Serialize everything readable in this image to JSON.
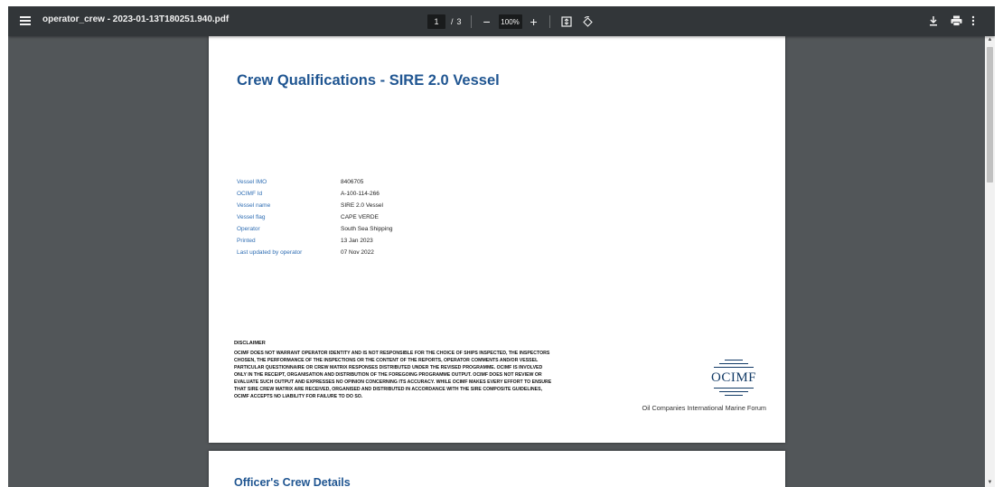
{
  "toolbar": {
    "file_title": "operator_crew - 2023-01-13T180251.940.pdf",
    "current_page": "1",
    "page_separator": "/",
    "total_pages": "3",
    "zoom_out": "−",
    "zoom_level": "100%",
    "zoom_in": "+",
    "icons": [
      "menu-icon",
      "fit-page-icon",
      "rotate-icon",
      "download-icon",
      "print-icon",
      "more-icon"
    ]
  },
  "document": {
    "title": "Crew Qualifications - SIRE 2.0 Vessel",
    "info": [
      {
        "label": "Vessel IMO",
        "value": "8406705"
      },
      {
        "label": "OCIMF Id",
        "value": "A-100-114-266"
      },
      {
        "label": "Vessel name",
        "value": "SIRE 2.0 Vessel"
      },
      {
        "label": "Vessel flag",
        "value": "CAPE VERDE"
      },
      {
        "label": "Operator",
        "value": "South Sea Shipping"
      },
      {
        "label": "Printed",
        "value": "13 Jan 2023"
      },
      {
        "label": "Last updated by operator",
        "value": "07 Nov 2022"
      }
    ],
    "disclaimer_title": "DISCLAIMER",
    "disclaimer_lines": [
      "OCIMF DOES NOT WARRANT OPERATOR IDENTITY AND IS NOT RESPONSIBLE FOR THE CHOICE OF SHIPS INSPECTED, THE INSPECTORS",
      "CHOSEN, THE PERFORMANCE OF THE INSPECTIONS OR THE CONTENT OF THE REPORTS, OPERATOR COMMENTS AND/OR VESSEL",
      "PARTICULAR QUESTIONNAIRE OR CREW MATRIX RESPONSES DISTRIBUTED UNDER THE REVISED PROGRAMME. OCIMF IS INVOLVED",
      "ONLY IN THE RECEIPT, ORGANISATION AND DISTRIBUTION OF THE FOREGOING PROGRAMME OUTPUT. OCIMF DOES NOT REVIEW OR",
      "EVALUATE SUCH OUTPUT AND EXPRESSES NO OPINION CONCERNING ITS ACCURACY. WHILE OCIMF MAKES EVERY EFFORT TO ENSURE",
      "THAT SIRE CREW MATRIX ARE RECEIVED, ORGANISED AND DISTRIBUTED IN ACCORDANCE WITH THE SIRE COMPOSITE GUIDELINES,",
      "OCIMF ACCEPTS NO LIABILITY FOR FAILURE TO DO SO."
    ],
    "logo_text": "OCIMF",
    "forum_name": "Oil Companies International Marine Forum",
    "page2_title": "Officer's Crew Details"
  },
  "colors": {
    "toolbar_bg": "#323639",
    "viewer_bg": "#525659",
    "title_blue": "#1f5591",
    "label_blue": "#2e6db3"
  }
}
